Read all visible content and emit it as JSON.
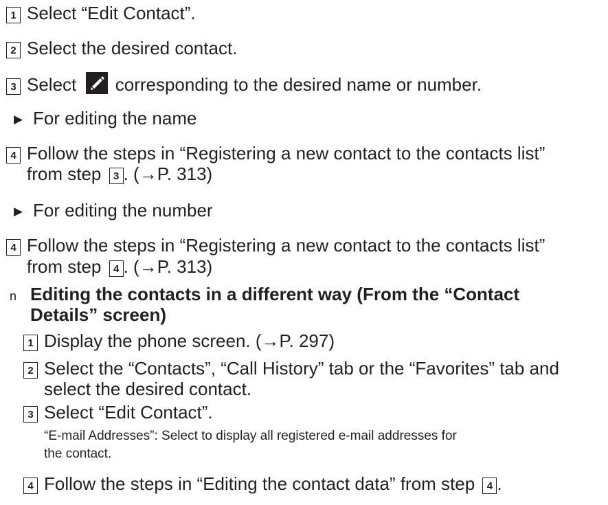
{
  "steps": {
    "s1": {
      "num": "1",
      "text": "Select “Edit Contact”."
    },
    "s2": {
      "num": "2",
      "text": "Select the desired contact."
    },
    "s3": {
      "num": "3",
      "pre": "Select",
      "post": "corresponding to the desired name or number."
    },
    "sub_name": "For editing the name",
    "s4a": {
      "num": "4",
      "line1": "Follow the steps in “Registering a new contact to the contacts list”",
      "line2_pre": "from step",
      "ref": "3",
      "line2_post": ". (→P. 313)"
    },
    "sub_number": "For editing the number",
    "s4b": {
      "num": "4",
      "line1": "Follow the steps in “Registering a new contact to the contacts list”",
      "line2_pre": "from step",
      "ref": "4",
      "line2_post": ". (→P. 313)"
    }
  },
  "section": {
    "bullet": "n",
    "heading_line1": "Editing the contacts in a different way (From the “Contact",
    "heading_line2": "Details” screen)",
    "t1": {
      "num": "1",
      "text": "Display the phone screen. (→P. 297)"
    },
    "t2": {
      "num": "2",
      "line1": "Select the “Contacts”, “Call History” tab or the “Favorites” tab and",
      "line2": "select the desired contact."
    },
    "t3": {
      "num": "3",
      "text": "Select “Edit Contact”."
    },
    "note_line1": "“E-mail Addresses”: Select to display all registered e-mail addresses for",
    "note_line2": "the contact.",
    "t4": {
      "num": "4",
      "pre": "Follow the steps in “Editing the contact data” from step",
      "ref": "4",
      "post": "."
    }
  },
  "icons": {
    "triangle": "▶",
    "pencil": "pencil-icon"
  }
}
